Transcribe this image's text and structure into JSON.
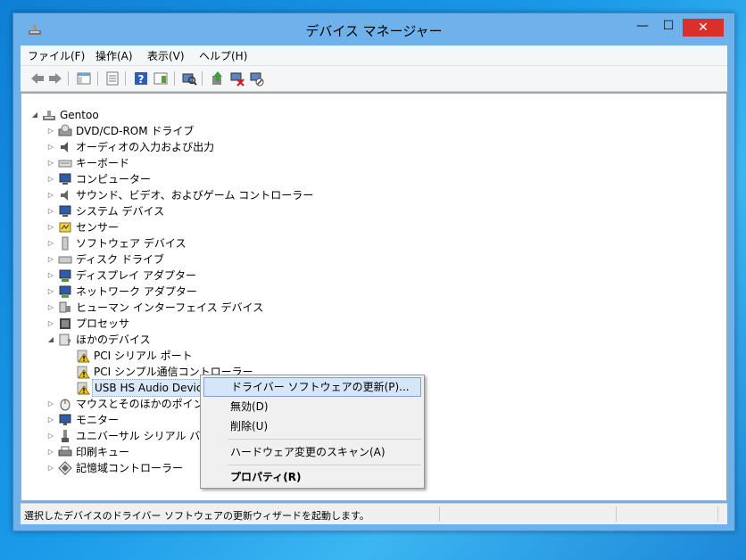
{
  "window": {
    "title": "デバイス マネージャー",
    "minimize_glyph": "—",
    "maximize_glyph": "☐",
    "close_glyph": "✕"
  },
  "menubar": [
    "ファイル(F)",
    "操作(A)",
    "表示(V)",
    "ヘルプ(H)"
  ],
  "toolbar_icons": [
    "back-arrow-icon",
    "forward-arrow-icon",
    "show-hide-console-tree-icon",
    "properties-icon",
    "help-icon",
    "action-pane-icon",
    "scan-hardware-icon",
    "update-driver-icon",
    "uninstall-device-icon",
    "disable-device-icon"
  ],
  "tree": {
    "root": "Gentoo",
    "categories": [
      {
        "label": "DVD/CD-ROM ドライブ",
        "icon": "dvd-drive-icon"
      },
      {
        "label": "オーディオの入力および出力",
        "icon": "speaker-icon"
      },
      {
        "label": "キーボード",
        "icon": "keyboard-icon"
      },
      {
        "label": "コンピューター",
        "icon": "computer-icon"
      },
      {
        "label": "サウンド、ビデオ、およびゲーム コントローラー",
        "icon": "sound-icon"
      },
      {
        "label": "システム デバイス",
        "icon": "system-device-icon"
      },
      {
        "label": "センサー",
        "icon": "sensor-icon"
      },
      {
        "label": "ソフトウェア デバイス",
        "icon": "software-device-icon"
      },
      {
        "label": "ディスク ドライブ",
        "icon": "disk-drive-icon"
      },
      {
        "label": "ディスプレイ アダプター",
        "icon": "display-adapter-icon"
      },
      {
        "label": "ネットワーク アダプター",
        "icon": "network-adapter-icon"
      },
      {
        "label": "ヒューマン インターフェイス デバイス",
        "icon": "hid-icon"
      },
      {
        "label": "プロセッサ",
        "icon": "processor-icon"
      },
      {
        "label": "ほかのデバイス",
        "icon": "unknown-device-icon",
        "expanded": true
      },
      {
        "label": "マウスとそのほかのポインティング デバイス",
        "icon": "mouse-icon"
      },
      {
        "label": "モニター",
        "icon": "monitor-icon"
      },
      {
        "label": "ユニバーサル シリアル バス コントローラー",
        "icon": "usb-icon"
      },
      {
        "label": "印刷キュー",
        "icon": "printer-icon"
      },
      {
        "label": "記憶域コントローラー",
        "icon": "storage-controller-icon"
      }
    ],
    "other_devices": [
      {
        "label": "PCI シリアル ポート",
        "icon": "warning-device-icon"
      },
      {
        "label": "PCI シンプル通信コントローラー",
        "icon": "warning-device-icon"
      },
      {
        "label": "USB HS Audio Device",
        "icon": "warning-device-icon",
        "selected": true
      }
    ]
  },
  "context_menu": {
    "update_driver": "ドライバー ソフトウェアの更新(P)...",
    "disable": "無効(D)",
    "uninstall": "削除(U)",
    "scan": "ハードウェア変更のスキャン(A)",
    "properties": "プロパティ(R)"
  },
  "statusbar": {
    "text": "選択したデバイスのドライバー ソフトウェアの更新ウィザードを起動します。"
  },
  "colors": {
    "accent": "#d9312a",
    "frame": "#6fb1ea",
    "selection": "#d5e6f8",
    "warning": "#f3c400"
  }
}
